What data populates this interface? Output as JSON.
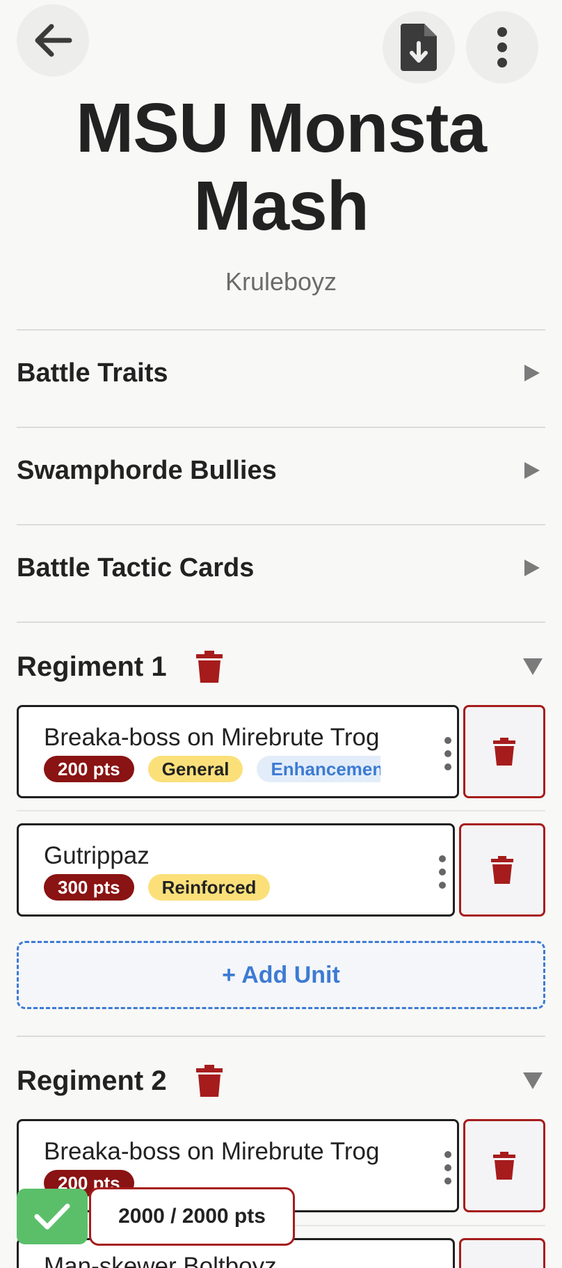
{
  "header": {
    "back_icon": "arrow-left-icon",
    "export_icon": "file-download-icon",
    "more_icon": "more-vertical-icon"
  },
  "army": {
    "title": "MSU Monsta Mash",
    "faction": "Kruleboyz"
  },
  "sections": [
    {
      "label": "Battle Traits",
      "expanded": false
    },
    {
      "label": "Swamphorde Bullies",
      "expanded": false
    },
    {
      "label": "Battle Tactic Cards",
      "expanded": false
    }
  ],
  "regiments": [
    {
      "label": "Regiment 1",
      "expanded": true,
      "units": [
        {
          "name": "Breaka-boss on Mirebrute Troggoth",
          "points": "200 pts",
          "tags": [
            "General",
            "Enhancement"
          ]
        },
        {
          "name": "Gutrippaz",
          "points": "300 pts",
          "tags": [
            "Reinforced"
          ]
        }
      ],
      "add_unit_label": "+ Add Unit"
    },
    {
      "label": "Regiment 2",
      "expanded": true,
      "units": [
        {
          "name": "Breaka-boss on Mirebrute Troggoth",
          "points": "200 pts",
          "tags": []
        },
        {
          "name": "Man-skewer Boltboyz",
          "points": "",
          "tags": []
        }
      ]
    }
  ],
  "footer": {
    "status_icon": "check-icon",
    "points_total": "2000 / 2000 pts"
  },
  "colors": {
    "points_badge": "#8a1313",
    "tag_yellow": "#fbe07a",
    "tag_blue_bg": "#e2edf9",
    "tag_blue_text": "#3d7bd3",
    "delete_red": "#a61c1c",
    "status_green": "#5bbf6a",
    "accent_blue": "#3d7bd3"
  }
}
